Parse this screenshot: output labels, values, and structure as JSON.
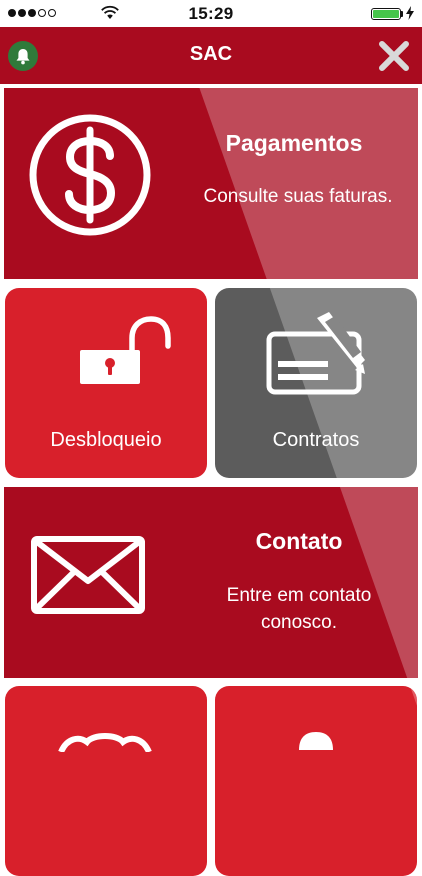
{
  "status_bar": {
    "time": "15:29",
    "signal_icon": "cellular-signal-icon",
    "signal_bars": 3,
    "signal_bars_total": 5,
    "wifi_icon": "wifi-icon",
    "battery_icon": "battery-icon",
    "battery_level": 1.0,
    "charging_icon": "charging-bolt-icon"
  },
  "nav": {
    "title": "SAC",
    "left_icon": "bell-icon",
    "right_icon": "close-icon"
  },
  "tiles": {
    "pagamentos": {
      "title": "Pagamentos",
      "description": "Consulte suas faturas.",
      "icon": "dollar-icon"
    },
    "desbloqueio": {
      "label": "Desbloqueio",
      "icon": "unlocked-padlock-icon"
    },
    "contratos": {
      "label": "Contratos",
      "icon": "contract-signature-icon"
    },
    "contato": {
      "title": "Contato",
      "description_line1": "Entre em contato",
      "description_line2": "conosco.",
      "icon": "envelope-icon"
    },
    "partial_left": {
      "icon": "partial-tile-icon"
    },
    "partial_right": {
      "icon": "partial-tile-icon"
    }
  },
  "colors": {
    "brand_red": "#a90b1f",
    "tile_red": "#d8202b",
    "tile_gray": "#5c5c5c",
    "bell_green": "#2f7a3a",
    "battery_green": "#45c54a"
  }
}
